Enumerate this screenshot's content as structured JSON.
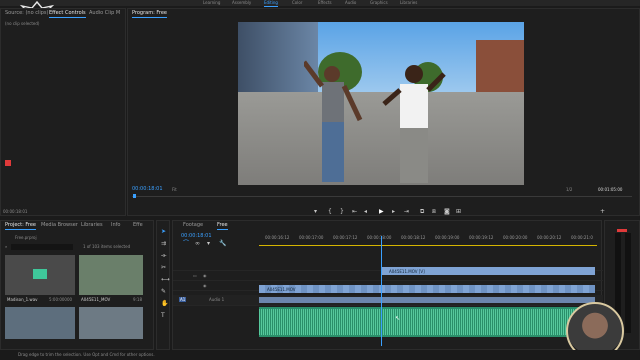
{
  "workspaces": [
    "Learning",
    "Assembly",
    "Editing",
    "Color",
    "Effects",
    "Audio",
    "Graphics",
    "Libraries"
  ],
  "active_workspace": "Editing",
  "source_panel": {
    "tabs": [
      "Source: (no clips)",
      "Effect Controls",
      "Audio Clip M"
    ],
    "active_tab": "Effect Controls",
    "empty_message": "(no clip selected)",
    "timecode": "00:00:18:01"
  },
  "program_monitor": {
    "title": "Program: Free",
    "timecode": "00:00:18:01",
    "fit": "Fit",
    "quality": "1/2",
    "duration": "00:01:05:00"
  },
  "project_panel": {
    "tabs": [
      "Project: Free",
      "Media Browser",
      "Libraries",
      "Info",
      "Effe"
    ],
    "active_tab": "Project: Free",
    "project_file": "Free.prproj",
    "item_count": "1 of 103 items selected",
    "items": [
      {
        "name": "Madison_1.wav",
        "duration": "5:00:00000"
      },
      {
        "name": "A045E11_MOV",
        "duration": "9:18"
      }
    ]
  },
  "timeline": {
    "tabs": [
      "Footage",
      "Free"
    ],
    "active_tab": "Free",
    "timecode": "00:00:18:01",
    "ruler_labels": [
      "00:00:16:12",
      "00:00:17:00",
      "00:00:17:12",
      "00:00:18:00",
      "00:00:18:12",
      "00:00:19:00",
      "00:00:19:12",
      "00:00:20:00",
      "00:00:20:12",
      "00:00:21:0"
    ],
    "clip_v2": "A045E11.MOV [V]",
    "clip_v1": "A045E11.MOV",
    "audio_track_label": "Audio 1"
  },
  "status_bar": {
    "message": "Drag edge to trim the selection. Use Opt and Cmd for other options."
  },
  "colors": {
    "accent": "#3aa0ff",
    "video_clip": "#7fa3d4",
    "audio_clip": "#2a8f6a"
  }
}
